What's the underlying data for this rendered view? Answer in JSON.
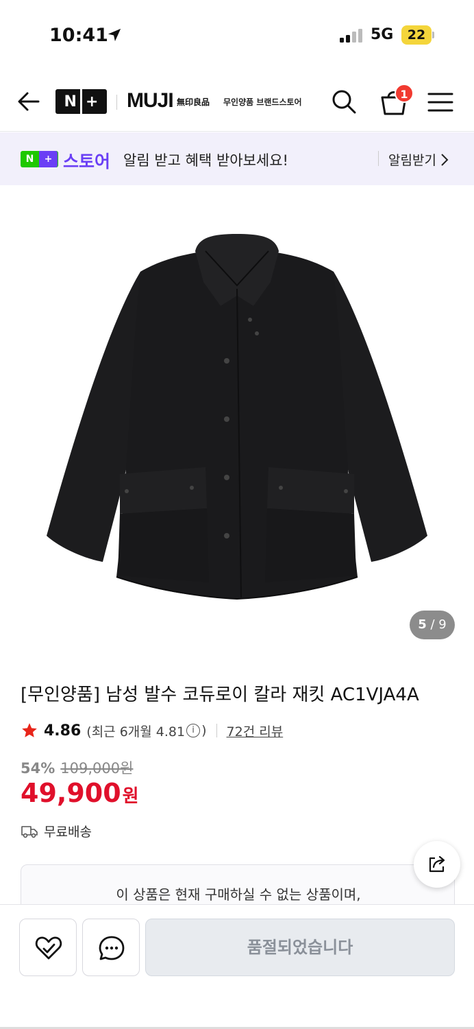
{
  "status_bar": {
    "time": "10:41",
    "network": "5G",
    "battery": "22"
  },
  "header": {
    "nplus_n": "N",
    "nplus_plus": "+",
    "brand_logo": "MUJI",
    "brand_kanji": "無印良品",
    "brand_store_label": "무인양품 브랜드스토어",
    "cart_count": "1",
    "icons": [
      "back-arrow-icon",
      "search-icon",
      "cart-icon",
      "menu-icon"
    ]
  },
  "notice": {
    "badge_n": "N",
    "badge_plus": "+",
    "store_word": "스토어",
    "message": "알림 받고 혜택 받아보세요!",
    "button_label": "알림받기"
  },
  "gallery": {
    "current": "5",
    "total": "9"
  },
  "product": {
    "title": "[무인양품] 남성 발수 코듀로이 칼라 재킷 AC1VJA4A",
    "rating": "4.86",
    "rating_recent_prefix": "(최근 6개월 4.81",
    "rating_recent_suffix": ")",
    "review_count_label": "72건 리뷰",
    "discount_rate": "54%",
    "original_price": "109,000원",
    "price": "49,900",
    "price_unit": "원",
    "shipping": "무료배송",
    "unavailable_message": "이 상품은 현재 구매하실 수 없는 상품이며,"
  },
  "bottom_bar": {
    "soldout_label": "품절되었습니다"
  },
  "colors": {
    "accent_purple": "#6a3ff5",
    "naver_green": "#1ec800",
    "price_red": "#e0102b",
    "badge_red": "#f13a30"
  }
}
